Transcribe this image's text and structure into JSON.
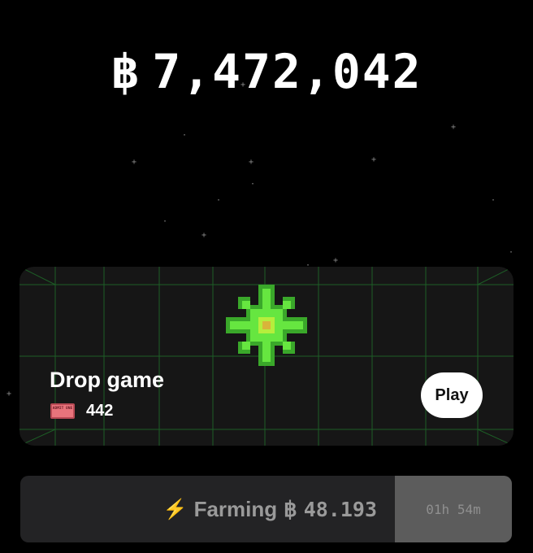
{
  "balance": {
    "currency_symbol": "฿",
    "amount": "7,472,042"
  },
  "drop_game": {
    "title": "Drop game",
    "ticket_icon_text": "ADMIT ONE",
    "ticket_count": "442",
    "play_label": "Play",
    "icon": "green-snowflake-gem-icon",
    "grid_color": "#1f6b2a"
  },
  "farming": {
    "icon": "lightning-bolt-icon",
    "label": "Farming",
    "currency_symbol": "฿",
    "amount": "48.193",
    "timer": "01h 54m"
  },
  "colors": {
    "background": "#000000",
    "card": "#161616",
    "gem_green": "#66e640",
    "bolt": "#f2b233",
    "ticket": "#e8747c"
  }
}
